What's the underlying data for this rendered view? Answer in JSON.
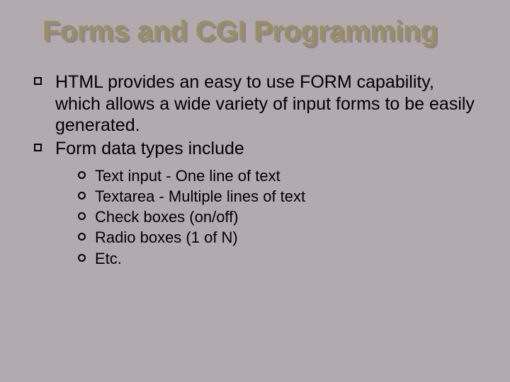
{
  "title": "Forms and CGI Programming",
  "bullets": {
    "b0": "HTML provides an easy  to use FORM capability, which allows a wide variety of input forms to be easily generated.",
    "b1": "Form data types include"
  },
  "sub": {
    "s0": "Text input - One line of text",
    "s1": "Textarea - Multiple lines of text",
    "s2": "Check boxes (on/off)",
    "s3": "Radio boxes (1 of N)",
    "s4": "Etc."
  }
}
